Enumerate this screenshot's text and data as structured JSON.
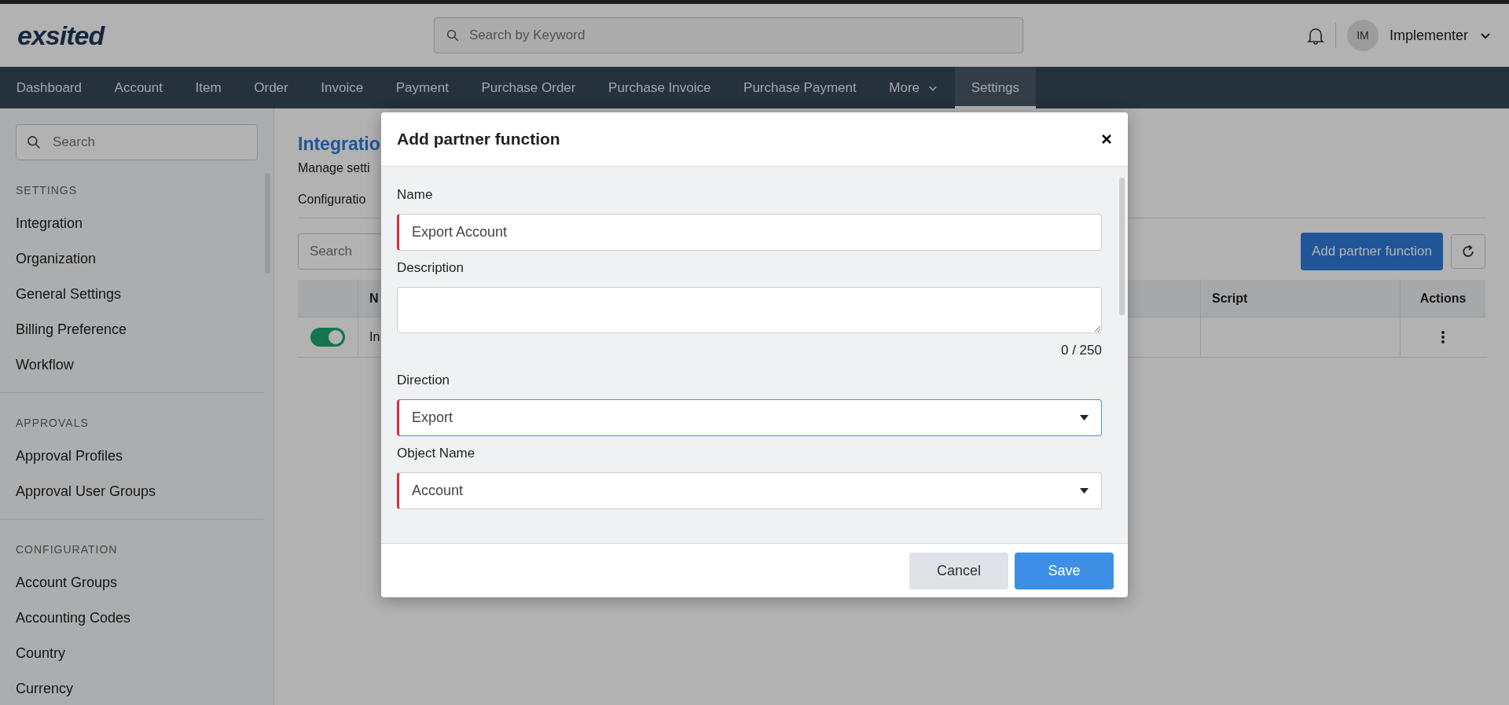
{
  "header": {
    "logo": "exsited",
    "search": {
      "placeholder": "Search by Keyword"
    },
    "user": {
      "initials": "IM",
      "name": "Implementer"
    }
  },
  "nav": [
    {
      "label": "Dashboard",
      "selected": false
    },
    {
      "label": "Account",
      "selected": false
    },
    {
      "label": "Item",
      "selected": false
    },
    {
      "label": "Order",
      "selected": false
    },
    {
      "label": "Invoice",
      "selected": false
    },
    {
      "label": "Payment",
      "selected": false
    },
    {
      "label": "Purchase Order",
      "selected": false
    },
    {
      "label": "Purchase Invoice",
      "selected": false
    },
    {
      "label": "Purchase Payment",
      "selected": false
    },
    {
      "label": "More",
      "selected": false,
      "kind": "menu"
    },
    {
      "label": "Settings",
      "selected": true
    }
  ],
  "sidebar": {
    "search": {
      "placeholder": "Search"
    },
    "sections": [
      {
        "title": "SETTINGS",
        "items": [
          "Integration",
          "Organization",
          "General Settings",
          "Billing Preference",
          "Workflow"
        ]
      },
      {
        "title": "APPROVALS",
        "items": [
          "Approval Profiles",
          "Approval User Groups"
        ]
      },
      {
        "title": "CONFIGURATION",
        "items": [
          "Account Groups",
          "Accounting Codes",
          "Country",
          "Currency"
        ]
      }
    ]
  },
  "content": {
    "title": "Integratio",
    "subtitle": "Manage setti",
    "tab": "Configuratio",
    "search": {
      "placeholder": "Search"
    },
    "add_button": "Add partner function",
    "table": {
      "columns": [
        "N",
        "Script",
        "Actions"
      ],
      "rows": [
        {
          "on": true,
          "name": "In"
        }
      ]
    }
  },
  "dialog": {
    "title": "Add partner function",
    "fields": [
      {
        "kind": "text",
        "label": "Name",
        "value": "Export Account",
        "required": true,
        "focused": false
      },
      {
        "kind": "textarea",
        "label": "Description",
        "counter": "0 / 250",
        "required": false,
        "focused": false
      },
      {
        "kind": "select",
        "label": "Direction",
        "value": "Export",
        "required": true,
        "focused": true
      },
      {
        "kind": "select",
        "label": "Object Name",
        "value": "Account",
        "required": true,
        "focused": false
      }
    ],
    "buttons": [
      {
        "label": "Cancel",
        "kind": "secondary"
      },
      {
        "label": "Save",
        "kind": "primary"
      }
    ]
  }
}
